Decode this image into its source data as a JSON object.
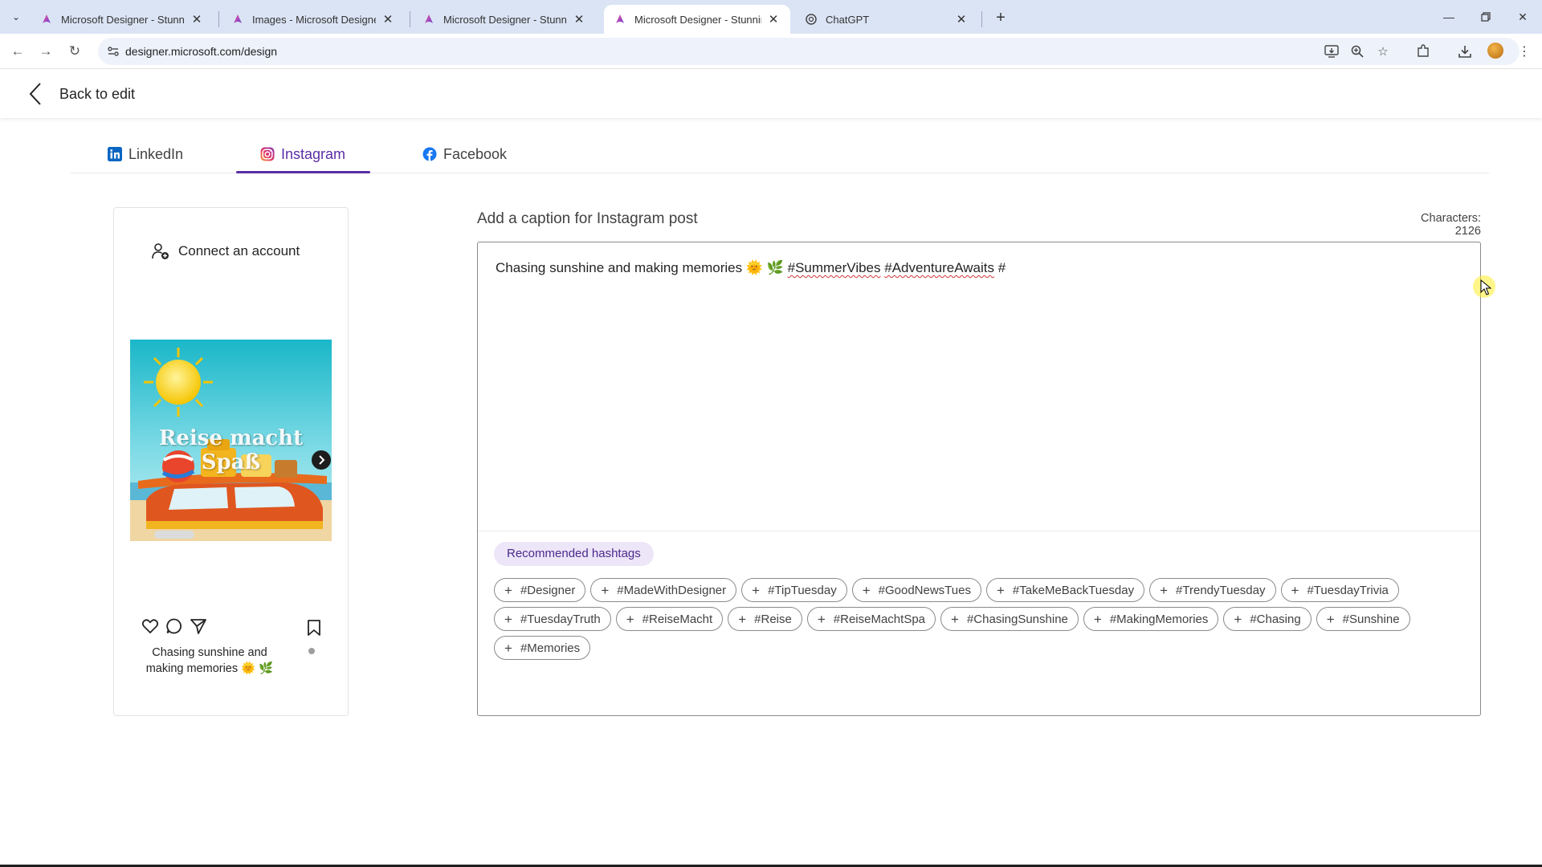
{
  "browser": {
    "tabs": [
      {
        "title": "Microsoft Designer - Stunning d",
        "active": false
      },
      {
        "title": "Images - Microsoft Designer",
        "active": false
      },
      {
        "title": "Microsoft Designer - Stunning d",
        "active": false
      },
      {
        "title": "Microsoft Designer - Stunning d",
        "active": true
      },
      {
        "title": "ChatGPT",
        "active": false
      }
    ],
    "url": "designer.microsoft.com/design"
  },
  "header": {
    "back_label": "Back to edit"
  },
  "social_tabs": [
    {
      "label": "LinkedIn",
      "active": false,
      "icon": "linkedin-icon"
    },
    {
      "label": "Instagram",
      "active": true,
      "icon": "instagram-icon"
    },
    {
      "label": "Facebook",
      "active": false,
      "icon": "facebook-icon"
    }
  ],
  "preview": {
    "connect_label": "Connect an account",
    "image_text": "Reise macht Spaß",
    "caption_line1": "Chasing sunshine and",
    "caption_line2": "making memories 🌞 🌿"
  },
  "caption": {
    "heading": "Add a caption for Instagram post",
    "characters_label": "Characters:",
    "characters_value": "2126",
    "text_prefix": "Chasing sunshine and making memories 🌞 🌿 ",
    "tag1": "#SummerVibes",
    "tag2": "#AdventureAwaits",
    "text_suffix": " #"
  },
  "hashtags": {
    "label": "Recommended hashtags",
    "row1": [
      "#Designer",
      "#MadeWithDesigner",
      "#TipTuesday",
      "#GoodNewsTues",
      "#TakeMeBackTuesday",
      "#TrendyTuesday",
      "#TuesdayTrivia"
    ],
    "row2": [
      "#TuesdayTruth",
      "#ReiseMacht",
      "#Reise",
      "#ReiseMachtSpa",
      "#ChasingSunshine",
      "#MakingMemories",
      "#Chasing",
      "#Sunshine"
    ],
    "row3": [
      "#Memories"
    ]
  },
  "colors": {
    "accent": "#5b2ea6",
    "tabstrip": "#dbe4f5",
    "chip_label_bg": "#ede5f8"
  }
}
